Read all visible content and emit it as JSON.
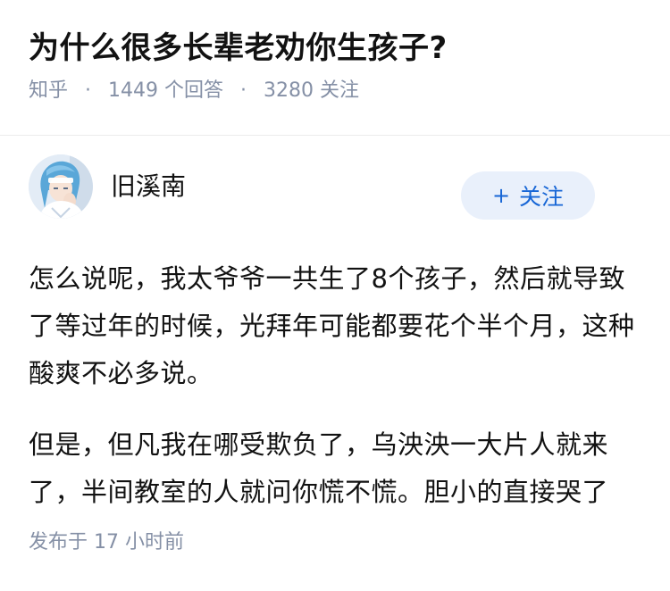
{
  "question": {
    "title": "为什么很多长辈老劝你生孩子?",
    "source": "知乎",
    "separator": "·",
    "answer_count": "1449",
    "answer_suffix": "个回答",
    "follower_count": "3280",
    "follower_suffix": "关注"
  },
  "answer": {
    "author_name": "旧溪南",
    "follow_icon": "+",
    "follow_label": "关注",
    "paragraphs": [
      "怎么说呢，我太爷爷一共生了8个孩子，然后就导致了等过年的时候，光拜年可能都要花个半个月，这种酸爽不必多说。",
      "但是，但凡我在哪受欺负了，乌泱泱一大片人就来了，半间教室的人就问你慌不慌。胆小的直接哭了"
    ],
    "published_label": "发布于",
    "published_time": "17 小时前"
  },
  "colors": {
    "meta_gray": "#8590a6",
    "follow_blue": "#1766d6",
    "follow_bg": "#e9f0fb",
    "text": "#121212"
  }
}
